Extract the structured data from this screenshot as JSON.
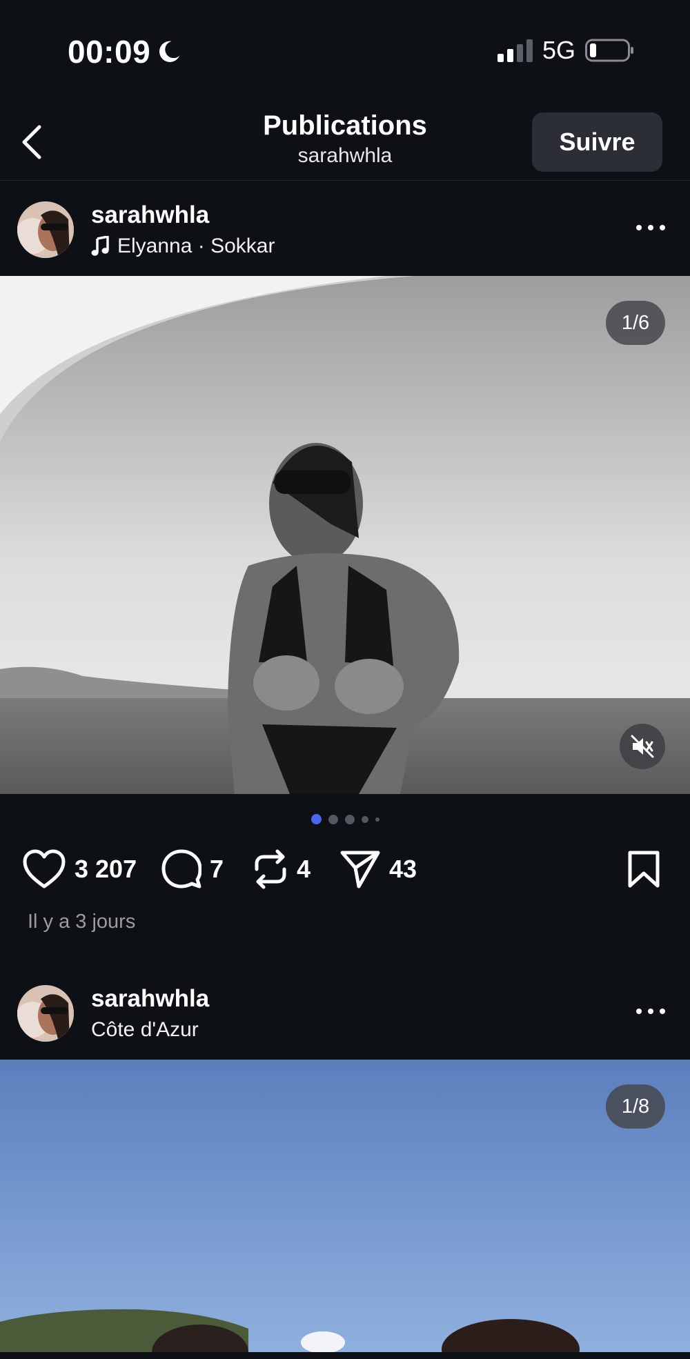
{
  "status_bar": {
    "time": "00:09",
    "network": "5G"
  },
  "header": {
    "title": "Publications",
    "subtitle": "sarahwhla",
    "follow_label": "Suivre"
  },
  "posts": [
    {
      "username": "sarahwhla",
      "subtitle": "Elyanna · Sokkar",
      "subtitle_icon": "music-note-icon",
      "counter": "1/6",
      "carousel_active": 0,
      "likes": "3 207",
      "comments": "7",
      "reposts": "4",
      "shares": "43",
      "timestamp": "Il y a 3 jours"
    },
    {
      "username": "sarahwhla",
      "subtitle": "Côte d'Azur",
      "counter": "1/8"
    }
  ],
  "colors": {
    "background": "#0d1014",
    "accent_dot": "#4a66f0",
    "follow_bg": "#2b2e35"
  }
}
